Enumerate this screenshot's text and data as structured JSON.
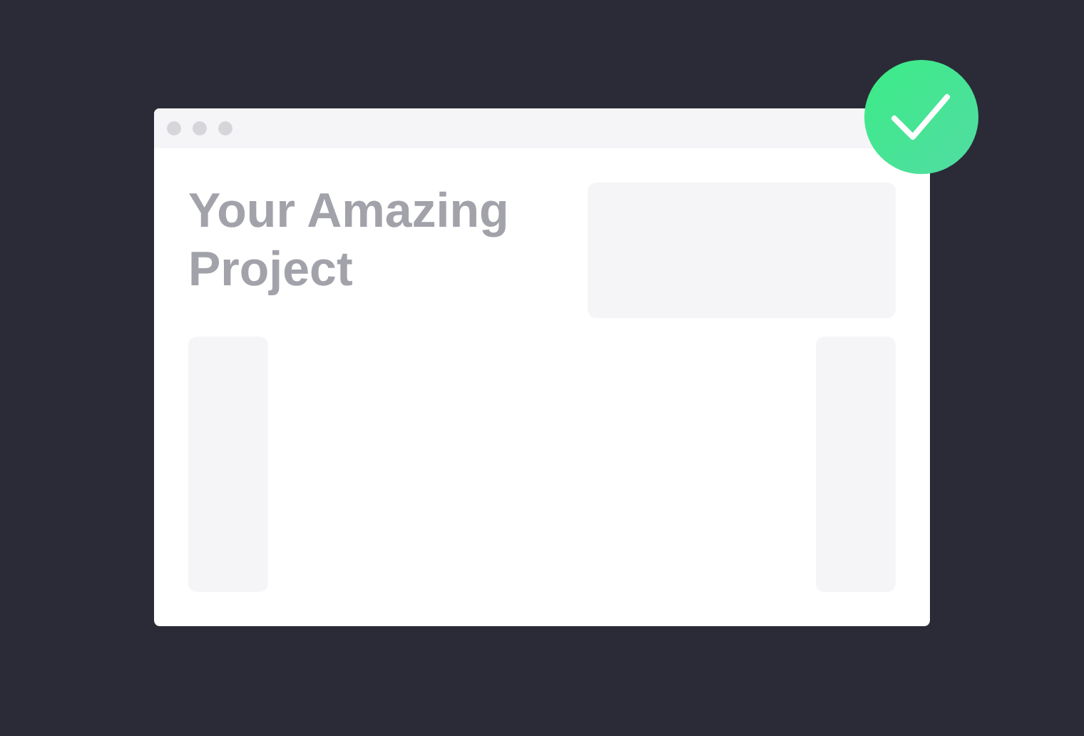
{
  "window": {
    "headline": "Your Amazing Project"
  },
  "badge": {
    "verified": true
  }
}
